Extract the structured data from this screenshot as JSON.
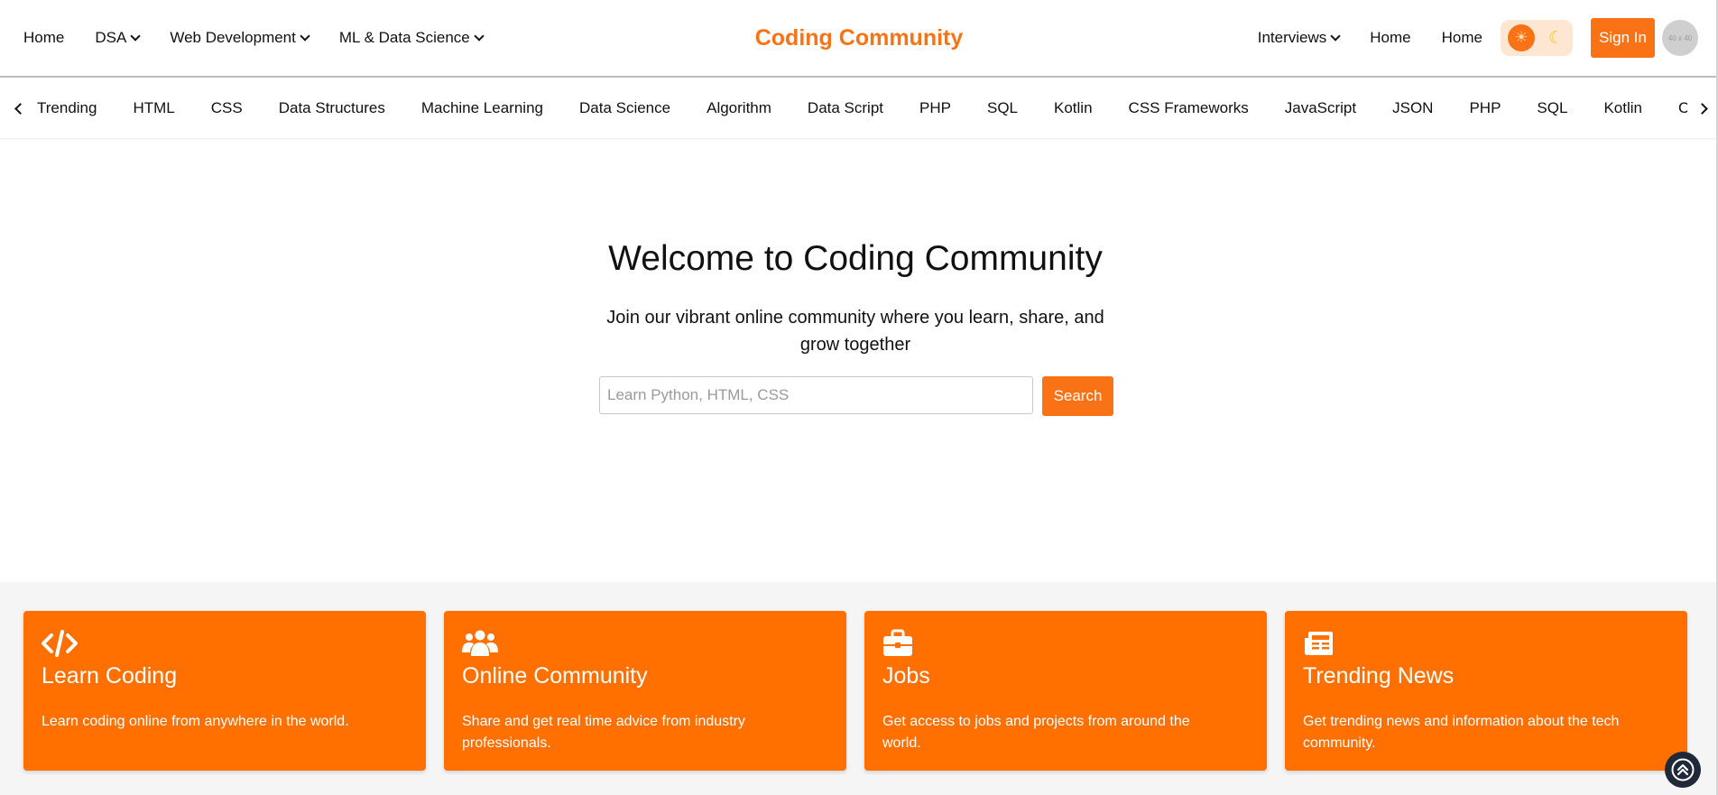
{
  "header": {
    "brand": "Coding Community",
    "nav_left": [
      {
        "label": "Home",
        "dropdown": false
      },
      {
        "label": "DSA",
        "dropdown": true
      },
      {
        "label": "Web Development",
        "dropdown": true
      },
      {
        "label": "ML & Data Science",
        "dropdown": true
      }
    ],
    "nav_right": [
      {
        "label": "Interviews",
        "dropdown": true
      },
      {
        "label": "Home",
        "dropdown": false
      },
      {
        "label": "Home",
        "dropdown": false
      }
    ],
    "theme_toggle": {
      "light_icon": "sun-icon",
      "dark_icon": "moon-icon"
    },
    "sign_in_label": "Sign In",
    "avatar_text": "40 x 40"
  },
  "topics": [
    "Trending",
    "HTML",
    "CSS",
    "Data Structures",
    "Machine Learning",
    "Data Science",
    "Algorithm",
    "Data Script",
    "PHP",
    "SQL",
    "Kotlin",
    "CSS Frameworks",
    "JavaScript",
    "JSON",
    "PHP",
    "SQL",
    "Kotlin",
    "CSS Frameworks"
  ],
  "hero": {
    "title": "Welcome to Coding Community",
    "subtitle": "Join our vibrant online community where you learn, share, and grow together",
    "search_placeholder": "Learn Python, HTML, CSS",
    "search_value": "",
    "search_button": "Search"
  },
  "features": [
    {
      "icon": "code-icon",
      "title": "Learn Coding",
      "description": "Learn coding online from anywhere in the world."
    },
    {
      "icon": "users-icon",
      "title": "Online Community",
      "description": "Share and get real time advice from industry professionals."
    },
    {
      "icon": "briefcase-icon",
      "title": "Jobs",
      "description": "Get access to jobs and projects from around the world."
    },
    {
      "icon": "newspaper-icon",
      "title": "Trending News",
      "description": "Get trending news and information about the tech community."
    }
  ],
  "colors": {
    "accent": "#f97316",
    "card": "#ff7000",
    "toggle_bg": "#fde7d3"
  }
}
